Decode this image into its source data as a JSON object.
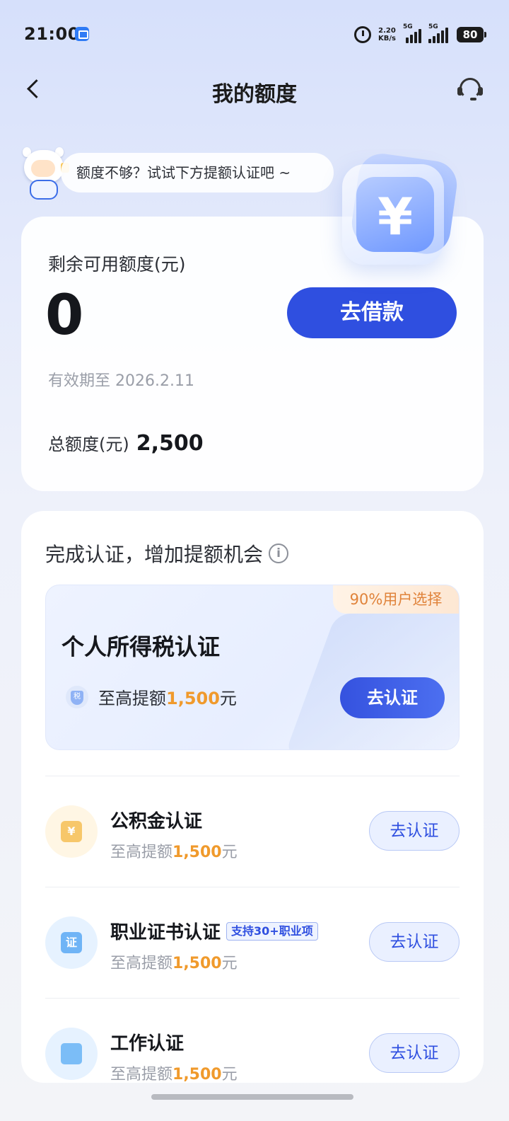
{
  "status_bar": {
    "time": "21:00",
    "net_speed_value": "2.20",
    "net_speed_unit": "KB/s",
    "signal_1_label": "5G",
    "signal_2_label": "5G",
    "battery": "80"
  },
  "nav": {
    "title": "我的额度"
  },
  "tip": {
    "text": "额度不够？试试下方提额认证吧 ~"
  },
  "quota": {
    "label": "剩余可用额度(元)",
    "amount": "0",
    "borrow_button": "去借款",
    "expire": "有效期至 2026.2.11",
    "total_label": "总额度(元)",
    "total_value": "2,500"
  },
  "certification": {
    "heading": "完成认证，增加提额机会",
    "featured": {
      "badge": "90%用户选择",
      "title": "个人所得税认证",
      "sub_prefix": "至高提额",
      "sub_amount": "1,500",
      "sub_suffix": "元",
      "button": "去认证"
    },
    "items": [
      {
        "name": "公积金认证",
        "tag": "",
        "sub_prefix": "至高提额",
        "sub_amount": "1,500",
        "sub_suffix": "元",
        "button": "去认证",
        "icon": "housing-fund-icon"
      },
      {
        "name": "职业证书认证",
        "tag": "支持30+职业项",
        "sub_prefix": "至高提额",
        "sub_amount": "1,500",
        "sub_suffix": "元",
        "button": "去认证",
        "icon": "certificate-icon",
        "icon_text": "证"
      },
      {
        "name": "工作认证",
        "tag": "",
        "sub_prefix": "至高提额",
        "sub_amount": "1,500",
        "sub_suffix": "元",
        "button": "去认证",
        "icon": "work-id-icon"
      }
    ]
  },
  "colors": {
    "primary": "#2f4fe0",
    "highlight": "#f09a2c",
    "badge_text": "#e0833a"
  }
}
